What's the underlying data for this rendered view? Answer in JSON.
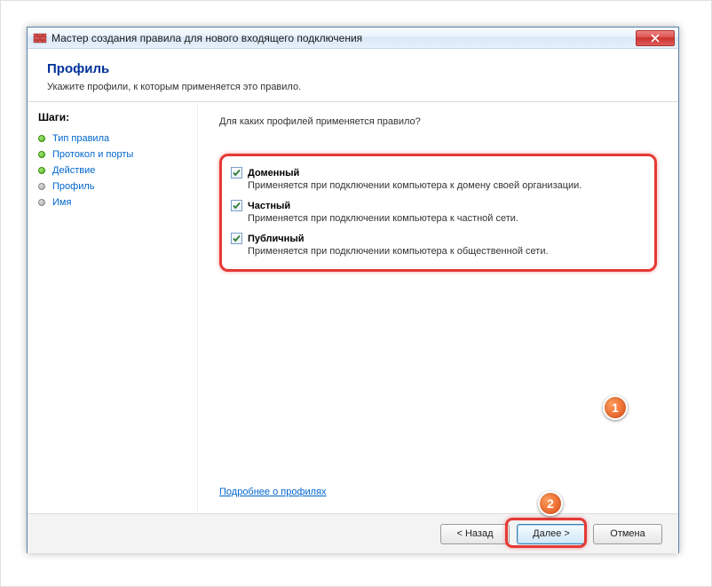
{
  "window": {
    "title": "Мастер создания правила для нового входящего подключения"
  },
  "header": {
    "title": "Профиль",
    "subtitle": "Укажите профили, к которым применяется это правило."
  },
  "sidebar": {
    "heading": "Шаги:",
    "steps": [
      {
        "label": "Тип правила",
        "done": true
      },
      {
        "label": "Протокол и порты",
        "done": true
      },
      {
        "label": "Действие",
        "done": true
      },
      {
        "label": "Профиль",
        "done": false
      },
      {
        "label": "Имя",
        "done": false
      }
    ]
  },
  "main": {
    "question": "Для каких профилей применяется правило?",
    "profiles": [
      {
        "name": "Доменный",
        "desc": "Применяется при подключении компьютера к домену своей организации.",
        "checked": true
      },
      {
        "name": "Частный",
        "desc": "Применяется при подключении компьютера к частной сети.",
        "checked": true
      },
      {
        "name": "Публичный",
        "desc": "Применяется при подключении компьютера к общественной сети.",
        "checked": true
      }
    ],
    "learn_more": "Подробнее о профилях"
  },
  "footer": {
    "back": "< Назад",
    "next": "Далее >",
    "cancel": "Отмена"
  },
  "markers": {
    "one": "1",
    "two": "2"
  }
}
